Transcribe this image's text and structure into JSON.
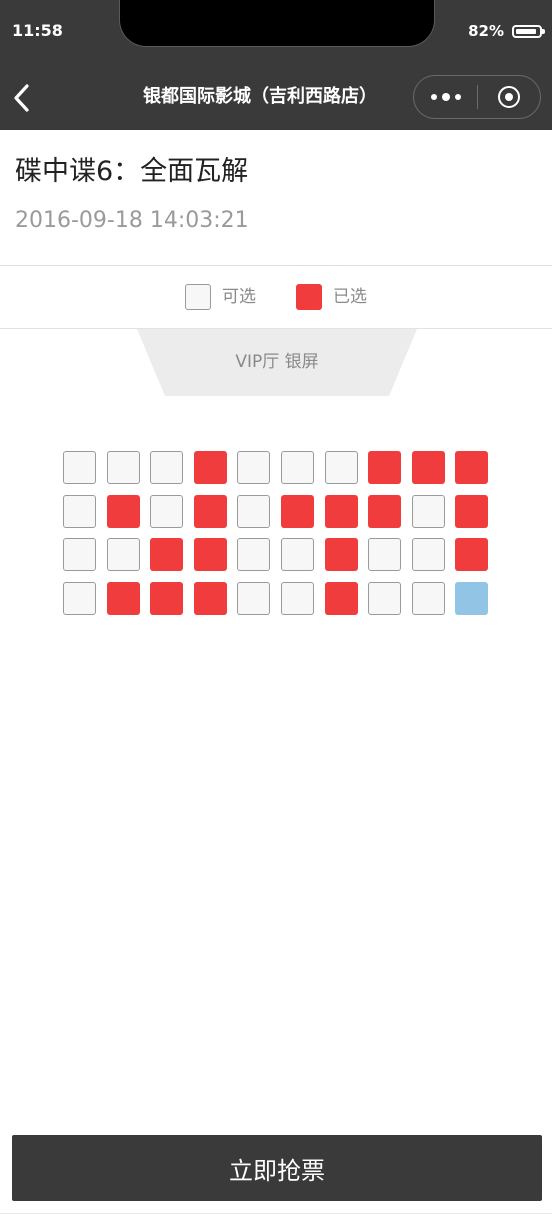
{
  "status_bar": {
    "time": "11:58",
    "battery_percent": "82%",
    "battery_level": 0.82
  },
  "nav": {
    "title": "银都国际影城（吉利西路店）",
    "back_icon": "chevron-left-icon",
    "more_icon": "more-dots-icon",
    "close_icon": "target-circle-icon"
  },
  "movie": {
    "title": "碟中谍6：全面瓦解",
    "showtime": "2016-09-18 14:03:21"
  },
  "legend": {
    "available_label": "可选",
    "selected_label": "已选"
  },
  "hall": {
    "screen_label": "VIP厅 银屏"
  },
  "seat_colors": {
    "available_fill": "#f7f7f7",
    "available_border": "#9a9a9a",
    "selected": "#f03c3c",
    "mine": "#92c4e6",
    "header": "#3a3a3a"
  },
  "seats": [
    [
      "available",
      "available",
      "available",
      "selected",
      "available",
      "available",
      "available",
      "selected",
      "selected",
      "selected"
    ],
    [
      "available",
      "selected",
      "available",
      "selected",
      "available",
      "selected",
      "selected",
      "selected",
      "available",
      "selected"
    ],
    [
      "available",
      "available",
      "selected",
      "selected",
      "available",
      "available",
      "selected",
      "available",
      "available",
      "selected"
    ],
    [
      "available",
      "selected",
      "selected",
      "selected",
      "available",
      "available",
      "selected",
      "available",
      "available",
      "mine"
    ]
  ],
  "buy_button": {
    "label": "立即抢票"
  }
}
